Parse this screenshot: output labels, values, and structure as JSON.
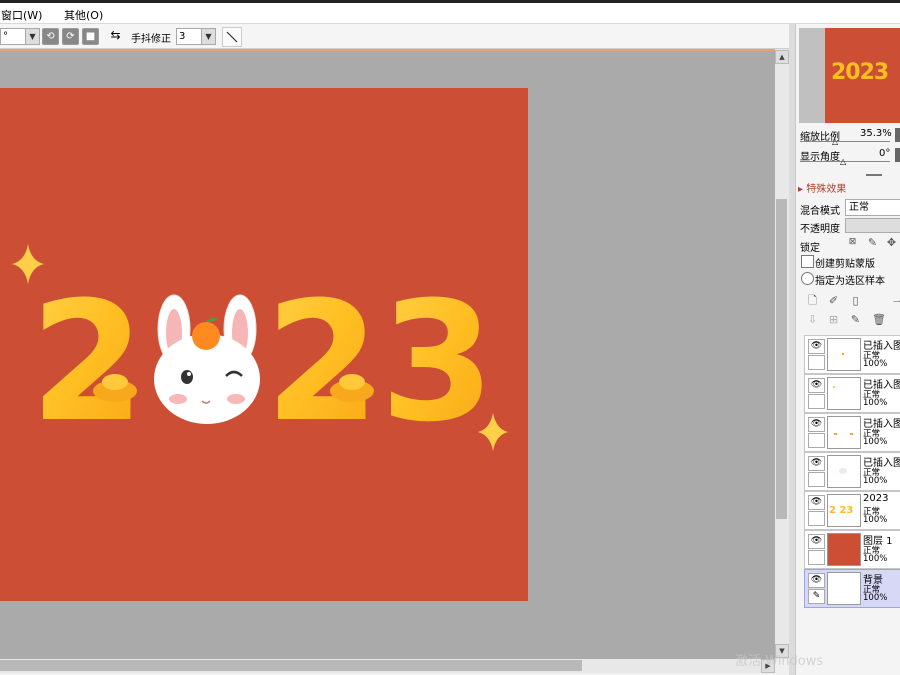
{
  "menu": {
    "window_label": "窗口(W)",
    "other_label": "其他(O)"
  },
  "toolbar": {
    "angle_value": "°",
    "stabilizer_label": "手抖修正",
    "stabilizer_value": "3"
  },
  "canvas": {
    "background_color": "#cc4f35",
    "year_text": "2023",
    "year_color": "#ffb820"
  },
  "navigator": {
    "zoom_label": "缩放比例",
    "zoom_value": "35.3%",
    "angle_label": "显示角度",
    "angle_value": "0°"
  },
  "effects_label": "特殊效果",
  "blend": {
    "label": "混合模式",
    "value": "正常"
  },
  "opacity": {
    "label": "不透明度"
  },
  "lock_label": "锁定",
  "options": {
    "clip_label": "创建剪贴蒙版",
    "sample_label": "指定为选区样本"
  },
  "layers": [
    {
      "name": "已插入图",
      "mode": "正常",
      "opacity": "100%"
    },
    {
      "name": "已插入图",
      "mode": "正常",
      "opacity": "100%"
    },
    {
      "name": "已插入图",
      "mode": "正常",
      "opacity": "100%"
    },
    {
      "name": "已插入图",
      "mode": "正常",
      "opacity": "100%"
    },
    {
      "name": "2023",
      "mode": "正常",
      "opacity": "100%",
      "thumb_text": "2 23"
    },
    {
      "name": "图层 1",
      "mode": "正常",
      "opacity": "100%"
    },
    {
      "name": "背景",
      "mode": "正常",
      "opacity": "100%"
    }
  ],
  "watermark": "激活 Windows"
}
